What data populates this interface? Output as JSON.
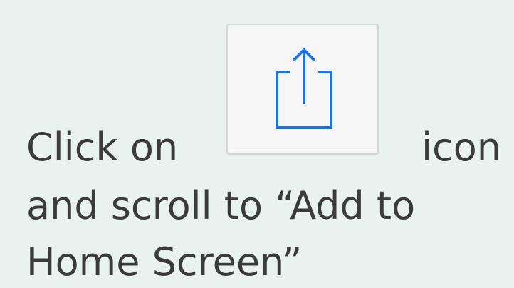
{
  "instructions": {
    "line1_prefix": "Click on",
    "line1_suffix": "icon",
    "line2": "and scroll to “Add to",
    "line3": "Home Screen”"
  },
  "share_button": {
    "icon": "share-icon",
    "icon_color": "#1a73e8"
  }
}
